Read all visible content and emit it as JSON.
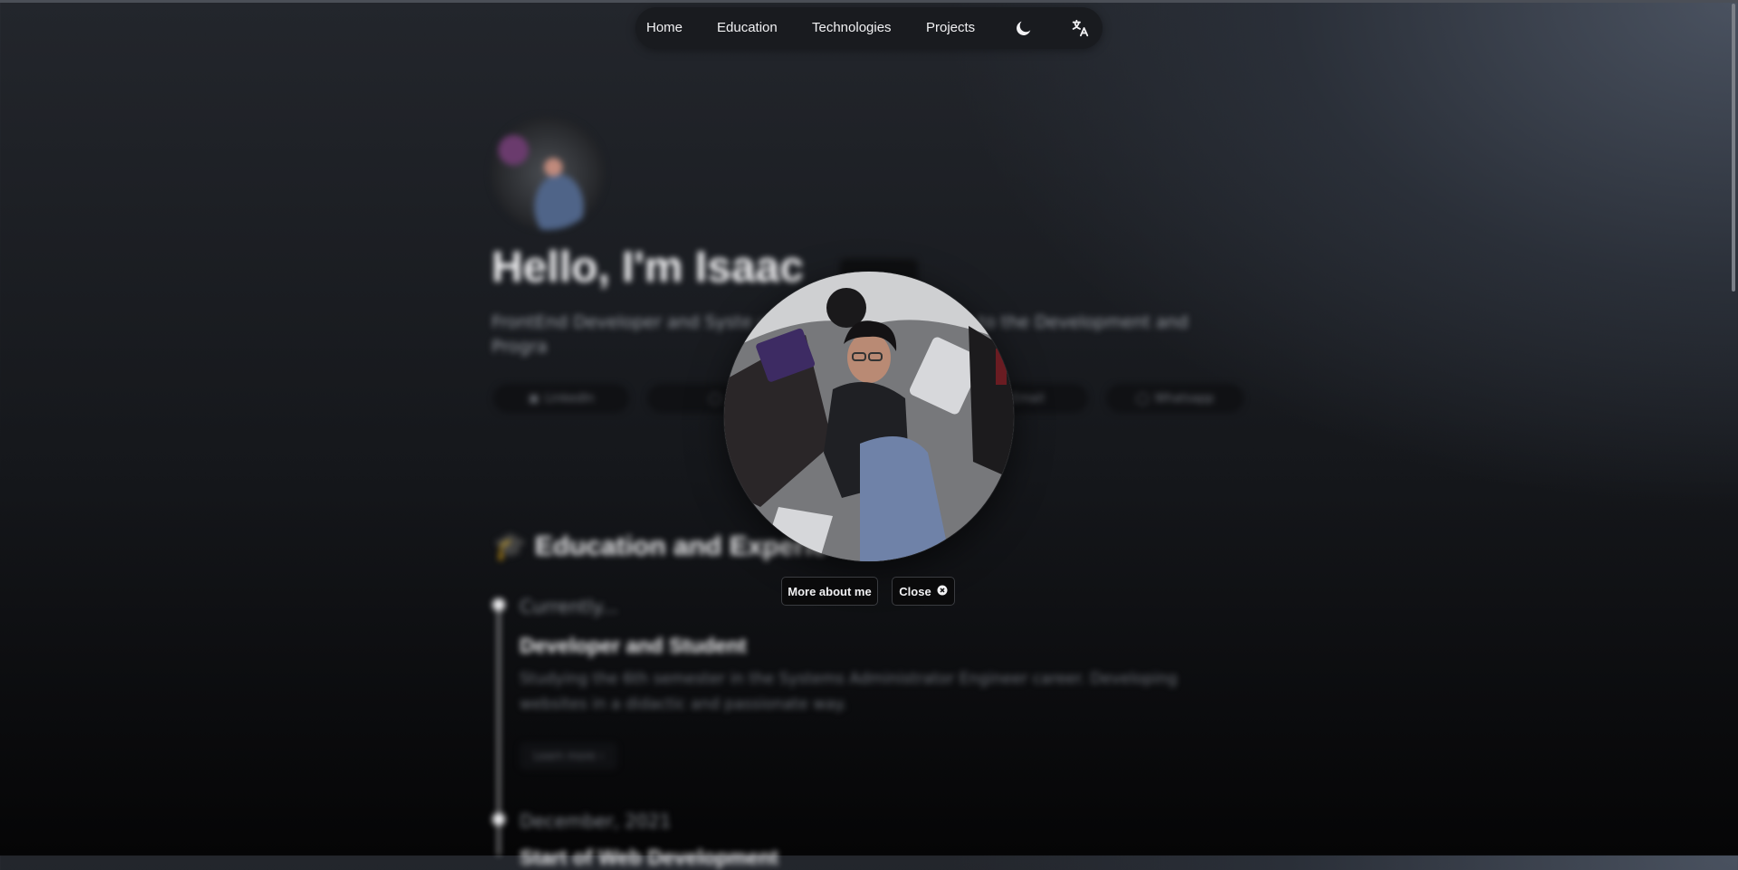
{
  "nav": {
    "items": [
      {
        "label": "Home"
      },
      {
        "label": "Education"
      },
      {
        "label": "Technologies"
      },
      {
        "label": "Projects"
      }
    ],
    "theme_icon": "moon-icon",
    "language_icon": "translate-icon"
  },
  "hero": {
    "title": "Hello, I'm Isaac",
    "description": "FrontEnd Developer and Syste                                         ulo, Mexico. Contributing to the Development and Progra",
    "links": [
      {
        "label": "LinkedIn",
        "icon": "linkedin-icon"
      },
      {
        "label": "",
        "icon": "github-icon"
      },
      {
        "label": "Email",
        "icon": "mail-icon"
      },
      {
        "label": "Whatsapp",
        "icon": "whatsapp-icon"
      }
    ]
  },
  "education": {
    "title": "Education and Experie",
    "items": [
      {
        "date": "Currently...",
        "title": "Developer and Student",
        "description": "Studying the 6th semester in the Systems Administrator Engineer career. Developing websites in a didactic and passionate way.",
        "button": "Learn more"
      },
      {
        "date": "December, 2021",
        "title": "Start of Web Development"
      }
    ]
  },
  "modal": {
    "more_label": "More about me",
    "close_label": "Close",
    "close_icon": "close-circle-icon",
    "photo": "profile-photo"
  },
  "colors": {
    "background_dark": "#050506",
    "background_light": "#4a5260",
    "nav_bg": "#191b1f",
    "button_bg": "#0a0a0b"
  }
}
